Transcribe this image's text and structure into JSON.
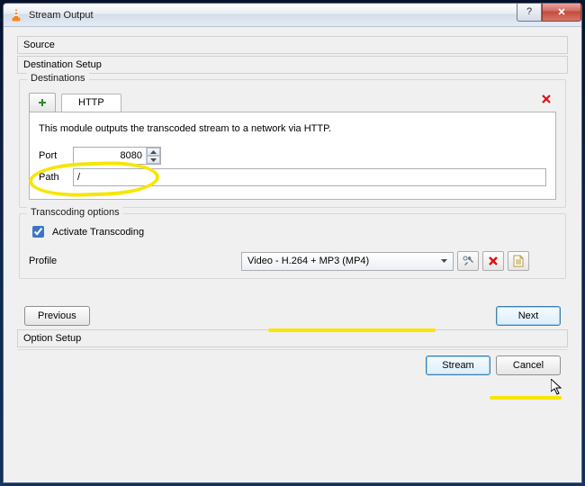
{
  "window": {
    "title": "Stream Output"
  },
  "sections": {
    "source": "Source",
    "destination_setup": "Destination Setup",
    "option_setup": "Option Setup"
  },
  "destinations": {
    "group_title": "Destinations",
    "active_tab": "HTTP",
    "description": "This module outputs the transcoded stream to a network via HTTP.",
    "port_label": "Port",
    "port_value": "8080",
    "path_label": "Path",
    "path_value": "/"
  },
  "transcoding": {
    "group_title": "Transcoding options",
    "activate_label": "Activate Transcoding",
    "activate_checked": true,
    "profile_label": "Profile",
    "profile_value": "Video - H.264 + MP3 (MP4)"
  },
  "buttons": {
    "previous": "Previous",
    "next": "Next",
    "stream": "Stream",
    "cancel": "Cancel"
  }
}
